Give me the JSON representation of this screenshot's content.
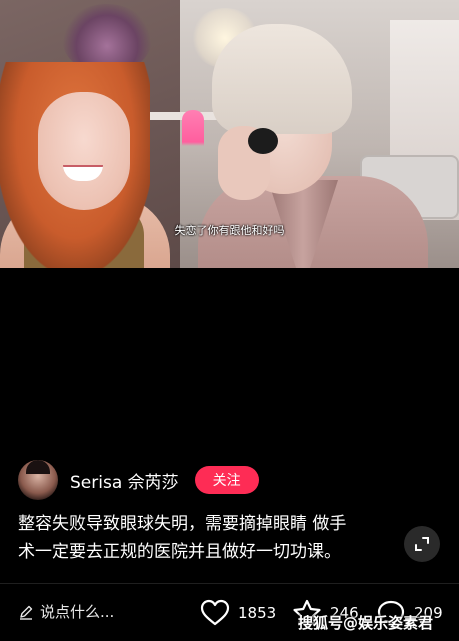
{
  "video": {
    "subtitle": "失恋了你有跟他和好吗"
  },
  "author": {
    "name": "Serisa 佘芮莎",
    "follow_label": "关注"
  },
  "caption": {
    "line1": "整容失败导致眼球失明，需要摘掉眼睛 做手",
    "line2": "术一定要去正规的医院并且做好一切功课。"
  },
  "bottom_bar": {
    "comment_placeholder": "说点什么...",
    "likes": "1853",
    "favorites": "246",
    "comments": "209"
  },
  "watermark": "搜狐号@娱乐姿素君",
  "icons": [
    "pencil-icon",
    "heart-icon",
    "star-icon",
    "comment-icon",
    "expand-icon"
  ]
}
